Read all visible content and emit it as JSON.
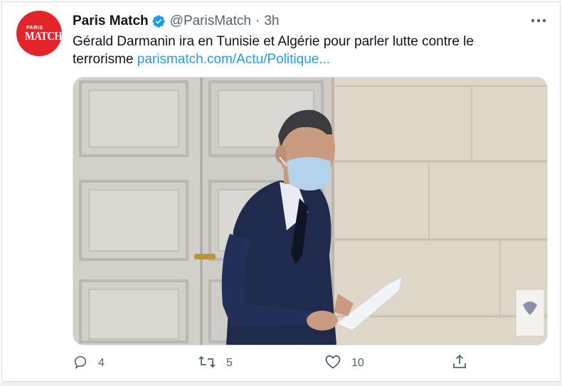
{
  "tweet": {
    "author_name": "Paris Match",
    "handle": "@ParisMatch",
    "separator": "·",
    "time": "3h",
    "avatar_text_small": "PARIS",
    "avatar_text_big": "MATCH",
    "text": "Gérald Darmanin ira en Tunisie et Algérie pour parler lutte contre le terrorisme ",
    "link_text": "parismatch.com/Actu/Politique...",
    "media_description_icon": "photo-man-in-suit-with-mask"
  },
  "actions": {
    "reply_count": "4",
    "retweet_count": "5",
    "like_count": "10",
    "share_count": ""
  },
  "colors": {
    "brand_red": "#e4232b",
    "verified_blue": "#1d9bf0",
    "link_blue": "#1d9bf0",
    "muted": "#536471"
  }
}
